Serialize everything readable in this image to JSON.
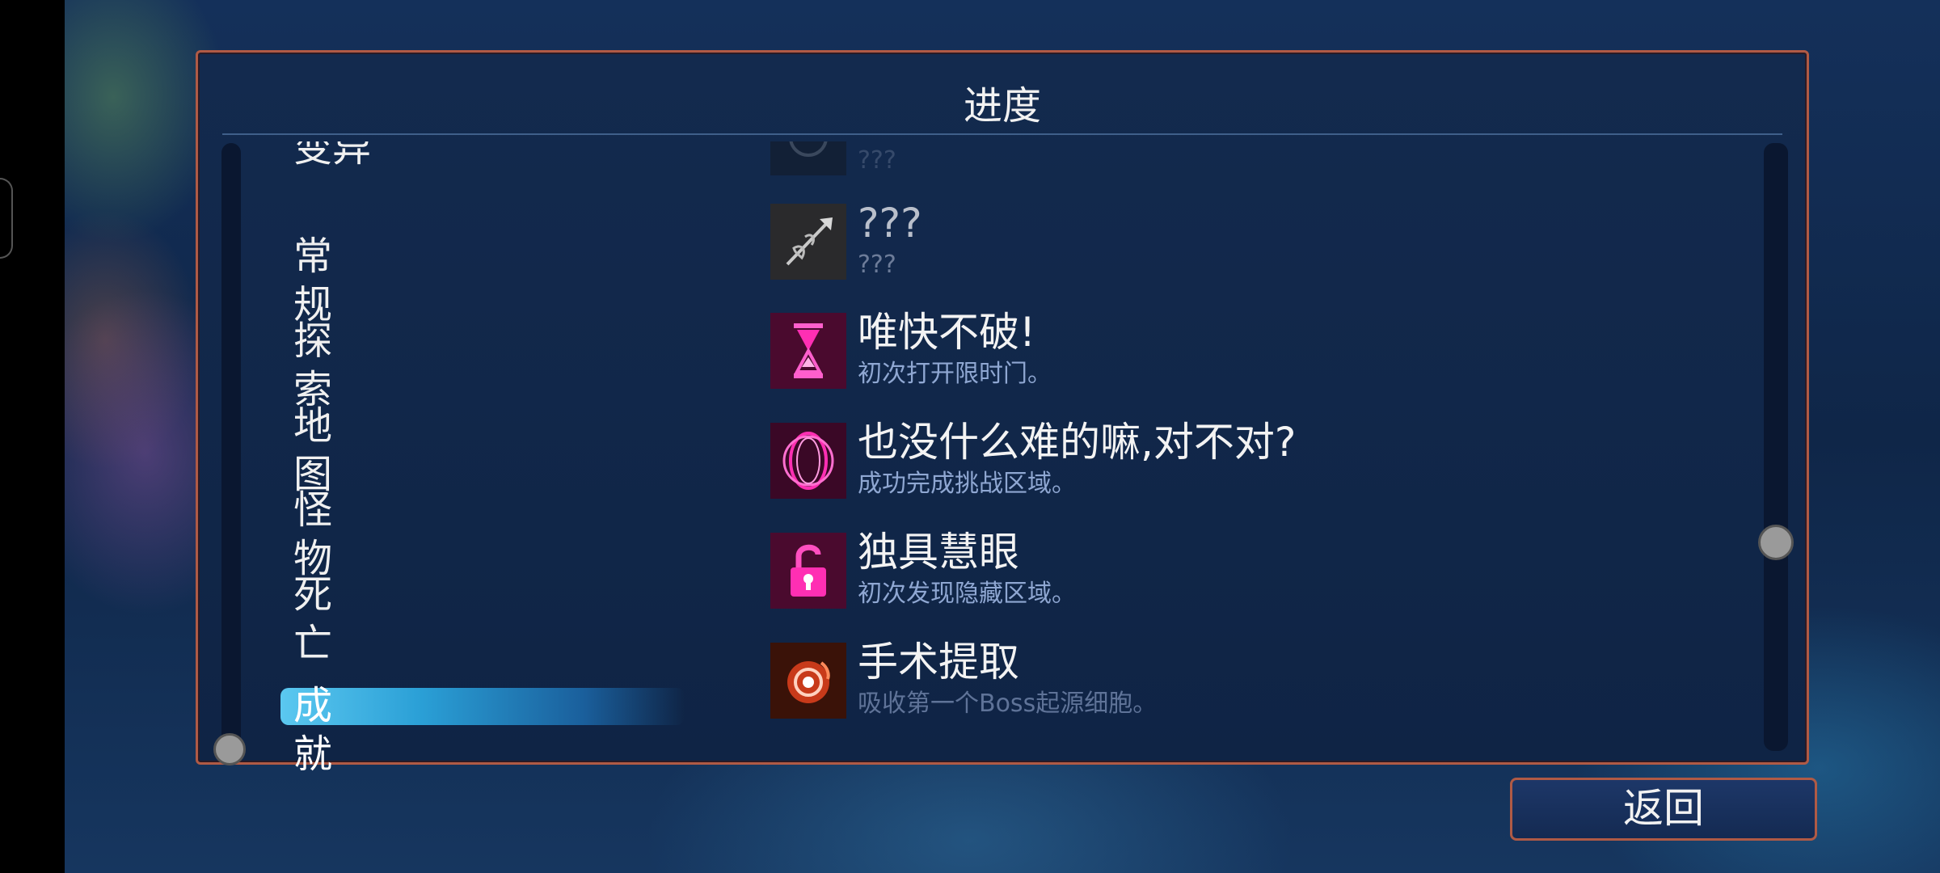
{
  "panel": {
    "title": "进度"
  },
  "categories": {
    "partial_top": "变异",
    "items": [
      "常规",
      "探索",
      "地图",
      "怪物",
      "死亡"
    ],
    "selected": "成就"
  },
  "achievements": [
    {
      "title": "",
      "desc": "???",
      "icon": "blurred-icon",
      "locked": true,
      "partial": true
    },
    {
      "title": "???",
      "desc": "???",
      "icon": "spear-icon",
      "locked": true
    },
    {
      "title": "唯快不破!",
      "desc": "初次打开限时门。",
      "icon": "hourglass-icon",
      "locked": false
    },
    {
      "title": "也没什么难的嘛,对不对?",
      "desc": "成功完成挑战区域。",
      "icon": "swirl-icon",
      "locked": false
    },
    {
      "title": "独具慧眼",
      "desc": "初次发现隐藏区域。",
      "icon": "unlocked-padlock-icon",
      "locked": false
    },
    {
      "title": "手术提取",
      "desc": "吸收第一个Boss起源细胞。",
      "icon": "cell-orb-icon",
      "locked": false
    }
  ],
  "buttons": {
    "back": "返回"
  },
  "colors": {
    "accent_border": "#b05a45",
    "neon_pink": "#ff2fb3",
    "selection": "#2a9fd6",
    "desc_text": "#8fa7d2"
  }
}
